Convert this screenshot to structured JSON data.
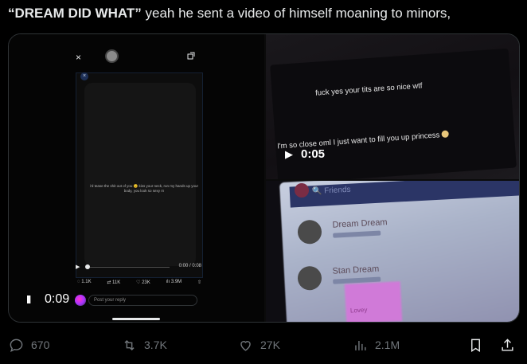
{
  "tweet": {
    "text_bold": "“DREAM DID WHAT”",
    "text_rest": " yeah he sent a video of himself moaning to minors,"
  },
  "media": {
    "left_video": {
      "close_glyph": "×",
      "phone_close_glyph": "×",
      "phone_caption": "i'd tease the shit out of you 😉 kiss your neck, run my hands up your body, you look so sexy rn",
      "inner_time": "0:00 / 0:08",
      "inner_stats": [
        "1.1K",
        "11K",
        "23K",
        "3.9M"
      ],
      "pause_glyph": "II",
      "time": "0:09",
      "reply_placeholder": "Post your reply"
    },
    "top_right_video": {
      "caption_1": "fuck yes your tits are so nice wtf",
      "caption_2": "I'm so close oml I just want to fill you up princess",
      "play_glyph": "▶",
      "time": "0:05"
    },
    "bottom_right_image": {
      "header_title": "Friends",
      "friends": [
        {
          "name": "Dream Dream"
        },
        {
          "name": "Stan Dream"
        }
      ],
      "pink_label": "Lovey"
    }
  },
  "actions": {
    "reply_count": "670",
    "retweet_count": "3.7K",
    "like_count": "27K",
    "views_count": "2.1M"
  },
  "colors": {
    "background": "#000000",
    "text": "#e7e9ea",
    "muted": "#71767b",
    "border": "#2f3336"
  }
}
